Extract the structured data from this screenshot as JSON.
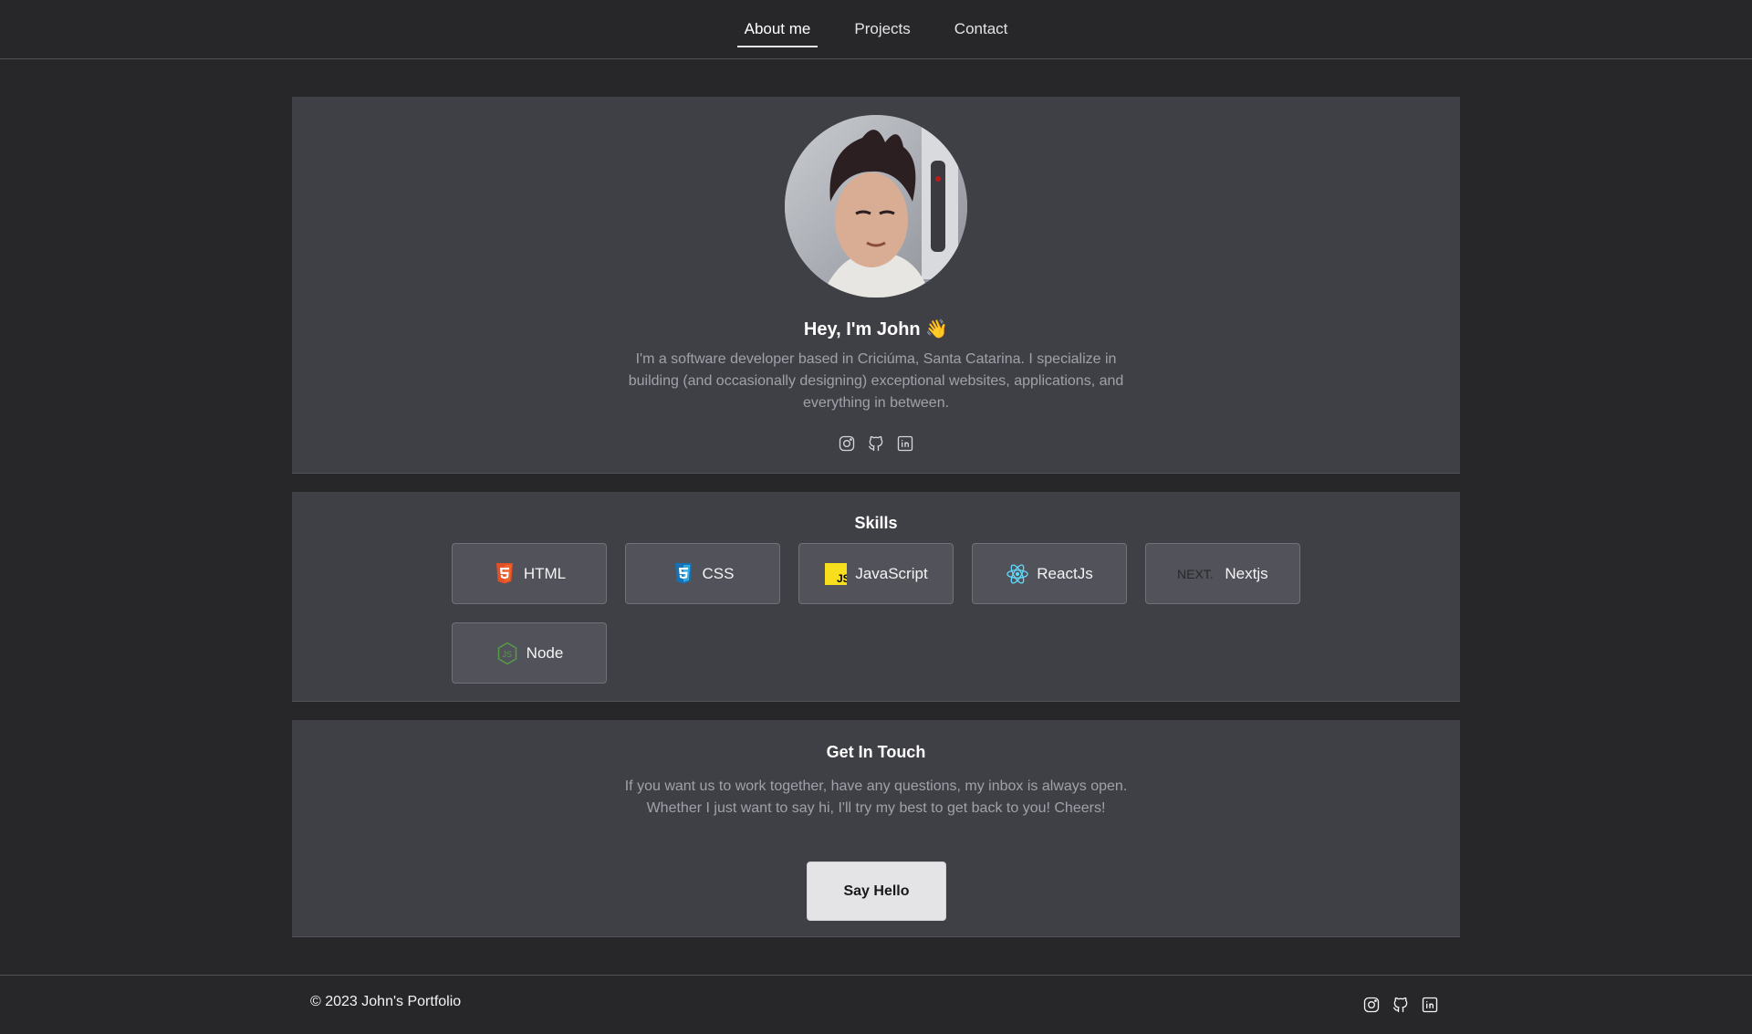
{
  "nav": {
    "items": [
      {
        "label": "About me",
        "active": true
      },
      {
        "label": "Projects",
        "active": false
      },
      {
        "label": "Contact",
        "active": false
      }
    ]
  },
  "about": {
    "greeting": "Hey, I'm John 👋",
    "bio": "I'm a software developer based in Criciúma, Santa Catarina. I specialize in building (and occasionally designing) exceptional websites, applications, and everything in between.",
    "socials": [
      "instagram-icon",
      "github-icon",
      "linkedin-icon"
    ]
  },
  "skills": {
    "title": "Skills",
    "items": [
      {
        "label": "HTML",
        "icon": "html5-icon"
      },
      {
        "label": "CSS",
        "icon": "css3-icon"
      },
      {
        "label": "JavaScript",
        "icon": "javascript-icon"
      },
      {
        "label": "ReactJs",
        "icon": "react-icon"
      },
      {
        "label": "Nextjs",
        "icon": "nextjs-icon"
      },
      {
        "label": "Node",
        "icon": "nodejs-icon"
      }
    ],
    "next_logo_text": "NEXT."
  },
  "contact": {
    "title": "Get In Touch",
    "text": "If you want us to work together, have any questions, my inbox is always open. Whether I just want to say hi, I'll try my best to get back to you! Cheers!",
    "button_label": "Say Hello"
  },
  "footer": {
    "copyright": "© 2023 John's Portfolio",
    "socials": [
      "instagram-icon",
      "github-icon",
      "linkedin-icon"
    ]
  },
  "colors": {
    "background": "#27272a",
    "card": "#3f3f46",
    "skill_button": "#52525b",
    "muted_text": "#a1a1aa",
    "button_bg": "#e4e4e7"
  }
}
